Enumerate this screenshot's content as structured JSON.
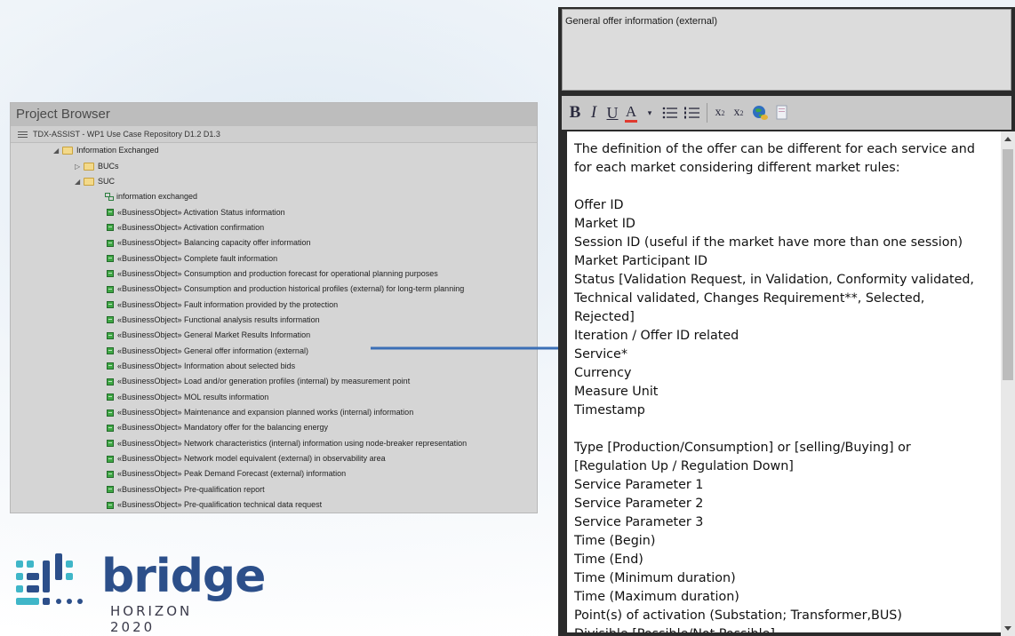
{
  "project_browser": {
    "title": "Project Browser",
    "repository": "TDX-ASSIST - WP1 Use Case Repository D1.2 D1.3",
    "folders": {
      "information_exchanged": "Information Exchanged",
      "bucs": "BUCs",
      "suc": "SUC"
    },
    "diagram": "information exchanged",
    "objects": [
      "«BusinessObject» Activation Status information",
      "«BusinessObject» Activation confirmation",
      "«BusinessObject» Balancing capacity offer information",
      "«BusinessObject» Complete fault information",
      "«BusinessObject» Consumption and production forecast for operational planning purposes",
      "«BusinessObject» Consumption and production historical profiles (external) for long-term planning",
      "«BusinessObject» Fault information provided by the protection",
      "«BusinessObject» Functional analysis results information",
      "«BusinessObject» General Market Results Information",
      "«BusinessObject» General offer information (external)",
      "«BusinessObject» Information about selected bids",
      "«BusinessObject» Load and/or generation profiles (internal) by measurement point",
      "«BusinessObject» MOL results information",
      "«BusinessObject» Maintenance and expansion  planned works (internal) information",
      "«BusinessObject» Mandatory offer for the balancing energy",
      "«BusinessObject» Network characteristics (internal) information using node-breaker representation",
      "«BusinessObject» Network model equivalent (external) in observability area",
      "«BusinessObject» Peak Demand Forecast (external) information",
      "«BusinessObject» Pre-qualification report",
      "«BusinessObject» Pre-qualification technical data request"
    ]
  },
  "editor": {
    "name_value": "General offer information (external)",
    "toolbar": {
      "bold": "B",
      "italic": "I",
      "underline": "U",
      "color": "A",
      "superscript": "x",
      "superscript_mark": "2",
      "subscript": "x",
      "subscript_mark": "2"
    },
    "text_lines": [
      "The definition of the offer can be different for each service and",
      "for each market considering different market rules:",
      "",
      "Offer ID",
      "Market ID",
      "Session ID (useful if the market have more than one session)",
      "Market Participant ID",
      "Status [Validation Request, in Validation, Conformity validated,",
      "Technical validated, Changes Requirement**, Selected,",
      "Rejected]",
      "Iteration / Offer ID related",
      "Service*",
      "Currency",
      "Measure Unit",
      "Timestamp",
      "",
      "Type [Production/Consumption] or [selling/Buying] or",
      "[Regulation Up / Regulation Down]",
      "Service Parameter 1",
      "Service Parameter 2",
      "Service Parameter 3",
      "Time (Begin)",
      "Time (End)",
      "Time (Minimum duration)",
      "Time (Maximum duration)",
      "Point(s) of activation (Substation; Transformer,BUS)",
      "Divisible [Possible/Not Possible]"
    ]
  },
  "logo": {
    "word": "bridge",
    "subtitle": "HORIZON 2020",
    "colors": {
      "primary": "#2c4f8a",
      "accent": "#3fb6c8"
    }
  },
  "colors": {
    "arrow": "#3b6fb6",
    "object_icon": "#3fa744",
    "folder": "#f3d98a"
  }
}
